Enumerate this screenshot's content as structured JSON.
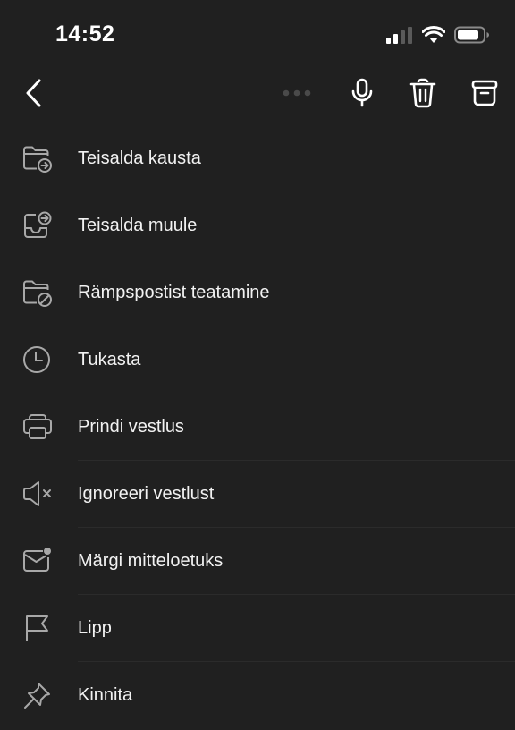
{
  "status_bar": {
    "time": "14:52"
  },
  "toolbar": {
    "back_icon": "chevron-left-icon",
    "more_icon": "more-dots-icon",
    "mic_icon": "microphone-icon",
    "delete_icon": "trash-icon",
    "archive_icon": "archive-icon"
  },
  "menu": {
    "items": [
      {
        "label": "Teisalda kausta",
        "icon": "folder-move-icon"
      },
      {
        "label": "Teisalda muule",
        "icon": "inbox-move-icon"
      },
      {
        "label": "Rämpspostist teatamine",
        "icon": "folder-block-icon"
      },
      {
        "label": "Tukasta",
        "icon": "clock-icon"
      },
      {
        "label": "Prindi vestlus",
        "icon": "printer-icon"
      },
      {
        "label": "Ignoreeri vestlust",
        "icon": "speaker-mute-icon"
      },
      {
        "label": "Märgi mitteloetuks",
        "icon": "mail-unread-icon"
      },
      {
        "label": "Lipp",
        "icon": "flag-icon"
      },
      {
        "label": "Kinnita",
        "icon": "pin-icon"
      }
    ]
  },
  "colors": {
    "background": "#202020",
    "text": "#f2f2f2",
    "icon": "#a8a8a8",
    "divider": "#2b2b2b"
  }
}
